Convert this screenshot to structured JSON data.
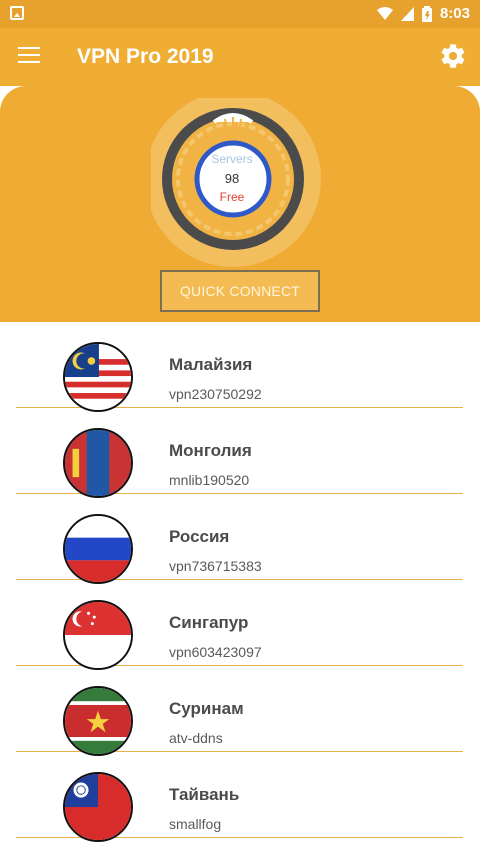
{
  "status_bar": {
    "time": "8:03",
    "wifi_icon": "wifi-icon",
    "signal_icon": "signal-icon",
    "battery_icon": "battery-icon"
  },
  "toolbar": {
    "title": "VPN Pro 2019",
    "menu_icon": "menu-icon",
    "settings_icon": "gear-icon"
  },
  "hero": {
    "servers_label": "Servers",
    "server_count": "98",
    "free_label": "Free",
    "quick_connect_label": "QUICK CONNECT"
  },
  "countries": [
    {
      "name": "Малайзия",
      "server": "vpn230750292",
      "flag_icon": "malaysia-flag-icon"
    },
    {
      "name": "Монголия",
      "server": "mnlib190520",
      "flag_icon": "mongolia-flag-icon"
    },
    {
      "name": "Россия",
      "server": "vpn736715383",
      "flag_icon": "russia-flag-icon"
    },
    {
      "name": "Сингапур",
      "server": "vpn603423097",
      "flag_icon": "singapore-flag-icon"
    },
    {
      "name": "Суринам",
      "server": "atv-ddns",
      "flag_icon": "suriname-flag-icon"
    },
    {
      "name": "Тайвань",
      "server": "smallfog",
      "flag_icon": "taiwan-flag-icon"
    }
  ],
  "colors": {
    "accent": "#efab34",
    "status_bar": "#e6a22c",
    "divider": "#e4b248",
    "free_text": "#e2402b"
  }
}
